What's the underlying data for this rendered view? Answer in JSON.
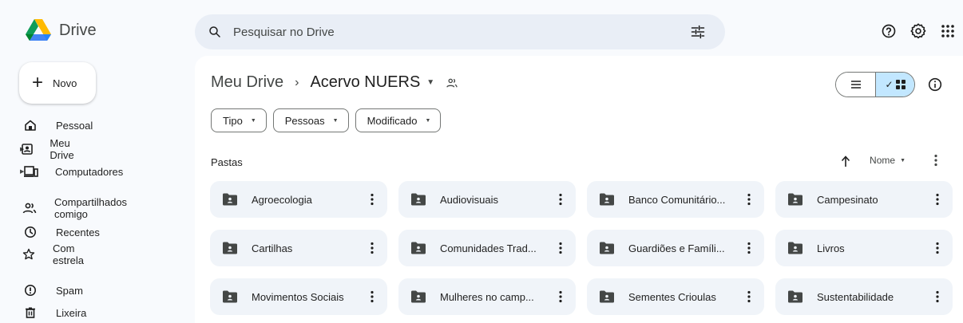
{
  "app": {
    "name": "Drive"
  },
  "search": {
    "placeholder": "Pesquisar no Drive",
    "value": ""
  },
  "sidebar": {
    "new_label": "Novo",
    "items": [
      {
        "label": "Pessoal",
        "icon": "home-icon"
      },
      {
        "label": "Meu Drive",
        "icon": "my-drive-icon"
      },
      {
        "label": "Computadores",
        "icon": "computer-icon"
      },
      {
        "label": "Compartilhados comigo",
        "icon": "shared-icon"
      },
      {
        "label": "Recentes",
        "icon": "clock-icon"
      },
      {
        "label": "Com estrela",
        "icon": "star-icon"
      },
      {
        "label": "Spam",
        "icon": "spam-icon"
      },
      {
        "label": "Lixeira",
        "icon": "trash-icon"
      }
    ]
  },
  "breadcrumb": {
    "root": "Meu Drive",
    "separator": "›",
    "current": "Acervo NUERS"
  },
  "filters": [
    {
      "label": "Tipo"
    },
    {
      "label": "Pessoas"
    },
    {
      "label": "Modificado"
    }
  ],
  "section": {
    "title": "Pastas",
    "sort_label": "Nome"
  },
  "folders": [
    {
      "name": "Agroecologia"
    },
    {
      "name": "Audiovisuais"
    },
    {
      "name": "Banco Comunitário..."
    },
    {
      "name": "Campesinato"
    },
    {
      "name": "Cartilhas"
    },
    {
      "name": "Comunidades Trad..."
    },
    {
      "name": "Guardiões e Famíli..."
    },
    {
      "name": "Livros"
    },
    {
      "name": "Movimentos Sociais"
    },
    {
      "name": "Mulheres no camp..."
    },
    {
      "name": "Sementes Crioulas"
    },
    {
      "name": "Sustentabilidade"
    }
  ],
  "colors": {
    "background": "#f8fafd",
    "search_bg": "#e9eef6",
    "folder_card_bg": "#f0f4f9",
    "grid_view_selected": "#c2e7ff",
    "text_primary": "#1f1f1f",
    "text_secondary": "#444746"
  }
}
